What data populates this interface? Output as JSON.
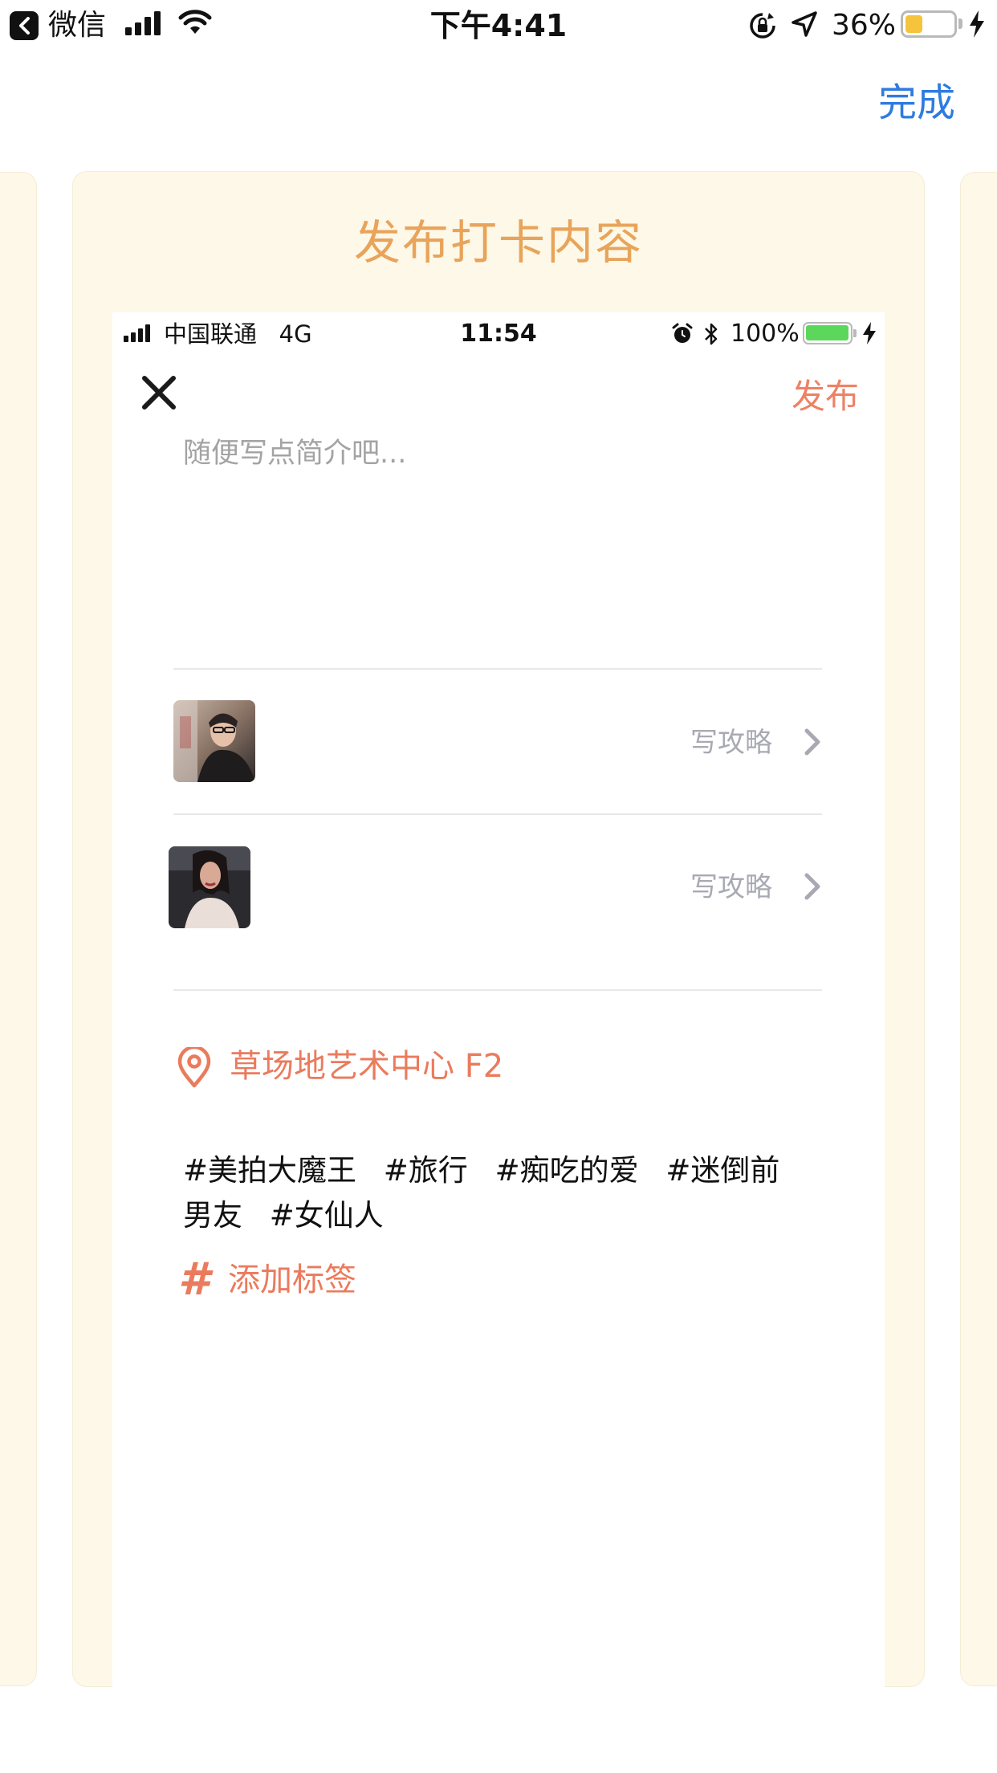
{
  "status_bar": {
    "back_app": "微信",
    "time": "下午4:41",
    "battery_percent": "36%",
    "battery_level": 0.36,
    "icons": [
      "back-icon",
      "signal-icon",
      "wifi-icon",
      "rotation-lock-icon",
      "location-arrow-icon",
      "battery-icon",
      "charging-bolt-icon"
    ]
  },
  "nav": {
    "done_label": "完成"
  },
  "card": {
    "title": "发布打卡内容"
  },
  "inner_status_bar": {
    "carrier": "中国联通",
    "network": "4G",
    "time": "11:54",
    "battery_percent": "100%",
    "battery_level": 1.0
  },
  "composer": {
    "publish_label": "发布",
    "intro_placeholder": "随便写点简介吧...",
    "photos": [
      {
        "guide_label": "写攻略"
      },
      {
        "guide_label": "写攻略"
      }
    ],
    "location": "草场地艺术中心 F2",
    "tags": [
      "#美拍大魔王",
      "#旅行",
      "#痴吃的爱",
      "#迷倒前男友",
      "#女仙人"
    ],
    "add_tag_symbol": "#",
    "add_tag_label": "添加标签"
  },
  "colors": {
    "accent_orange": "#e8a45a",
    "coral": "#ea7b5d",
    "link_blue": "#2f7be0",
    "card_bg": "#fdf8e8"
  }
}
